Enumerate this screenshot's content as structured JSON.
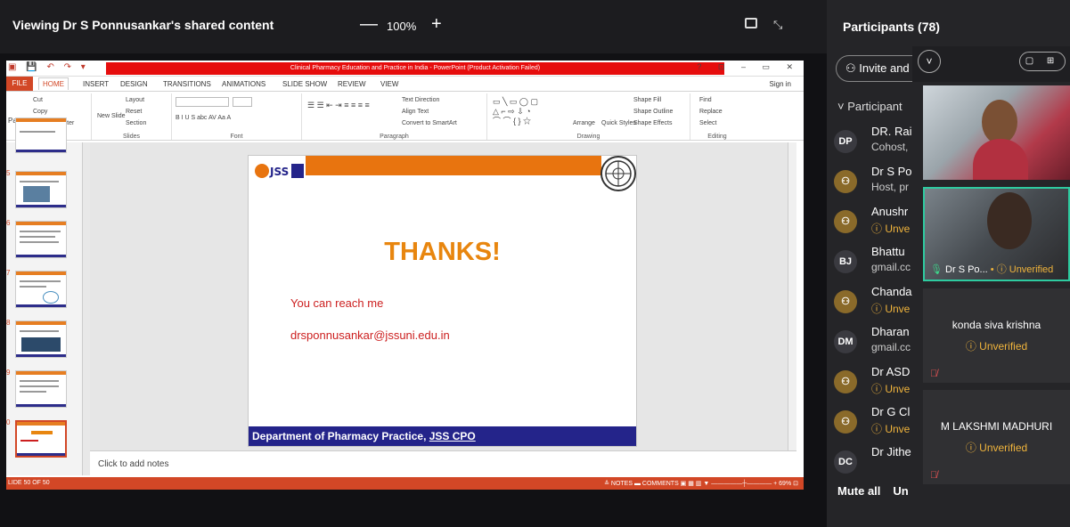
{
  "viewbar": {
    "title": "Viewing Dr S Ponnusankar's shared content",
    "zoom_minus": "—",
    "zoom_value": "100%",
    "zoom_plus": "+"
  },
  "ppt": {
    "window_title": "Clinical Pharmacy Education and Practice in India - PowerPoint (Product Activation Failed)",
    "window_controls": "? ⊡ – ▭ ✕",
    "tabs": [
      "FILE",
      "HOME",
      "INSERT",
      "DESIGN",
      "TRANSITIONS",
      "ANIMATIONS",
      "SLIDE SHOW",
      "REVIEW",
      "VIEW"
    ],
    "sign_in": "Sign in",
    "ribbon": {
      "clipboard": {
        "label": "Clipboard",
        "paste": "Paste",
        "cut": "Cut",
        "copy": "Copy",
        "format_painter": "Format Painter"
      },
      "slides": {
        "label": "Slides",
        "new_slide": "New Slide",
        "layout": "Layout",
        "reset": "Reset",
        "section": "Section"
      },
      "font": {
        "label": "Font",
        "buttons": "B  I  U  S  abc  AV  Aa  A"
      },
      "paragraph": {
        "label": "Paragraph",
        "text_direction": "Text Direction",
        "align_text": "Align Text",
        "convert_smartart": "Convert to SmartArt"
      },
      "drawing": {
        "label": "Drawing",
        "arrange": "Arrange",
        "quick_styles": "Quick Styles",
        "shape_fill": "Shape Fill",
        "shape_outline": "Shape Outline",
        "shape_effects": "Shape Effects"
      },
      "editing": {
        "label": "Editing",
        "find": "Find",
        "replace": "Replace",
        "select": "Select"
      }
    },
    "thumbnails": [
      {
        "num": "5"
      },
      {
        "num": "6"
      },
      {
        "num": "7"
      },
      {
        "num": "8"
      },
      {
        "num": "9"
      },
      {
        "num": "0"
      }
    ],
    "slide": {
      "thanks": "THANKS!",
      "reach": "You can reach me",
      "email": "drsponnusankar@jssuni.edu.in",
      "footer_main": "Department of Pharmacy Practice, ",
      "footer_link": "JSS CPO"
    },
    "notes_placeholder": "Click to add notes",
    "status_left": "LIDE 50 OF 50",
    "status_right": "≙ NOTES   ▬ COMMENTS   ▣  ▦  ▥  ▼  —————┼———— +  69%  ⊡"
  },
  "panel": {
    "title": "Participants (78)",
    "invite": "Invite and",
    "list_head": "Participant",
    "participants": [
      {
        "avatar": "DP",
        "name": "DR. Rai",
        "sub": "Cohost,",
        "unverified": false
      },
      {
        "avatar": "",
        "name": "Dr S Po",
        "sub": "Host, pr",
        "unverified": false
      },
      {
        "avatar": "",
        "name": "Anushr",
        "sub": "Unve",
        "unverified": true
      },
      {
        "avatar": "BJ",
        "name": "Bhattu",
        "sub": "gmail.cc",
        "unverified": false
      },
      {
        "avatar": "",
        "name": "Chanda",
        "sub": "Unve",
        "unverified": true
      },
      {
        "avatar": "DM",
        "name": "Dharan",
        "sub": "gmail.cc",
        "unverified": false
      },
      {
        "avatar": "",
        "name": "Dr ASD",
        "sub": "Unve",
        "unverified": true
      },
      {
        "avatar": "",
        "name": "Dr G Cl",
        "sub": "Unve",
        "unverified": true
      },
      {
        "avatar": "DC",
        "name": "Dr Jithe",
        "sub": "",
        "unverified": false
      }
    ],
    "mute_all": "Mute all",
    "unmute": "Un"
  },
  "video": {
    "chevron": "˅",
    "layout": "▢ ⊞",
    "cam2_name": "Dr S Po...",
    "cam2_status": "Unverified",
    "tiles": [
      {
        "name": "konda siva krishna",
        "status": "Unverified"
      },
      {
        "name": "M LAKSHMI MADHURI",
        "status": "Unverified"
      }
    ]
  }
}
